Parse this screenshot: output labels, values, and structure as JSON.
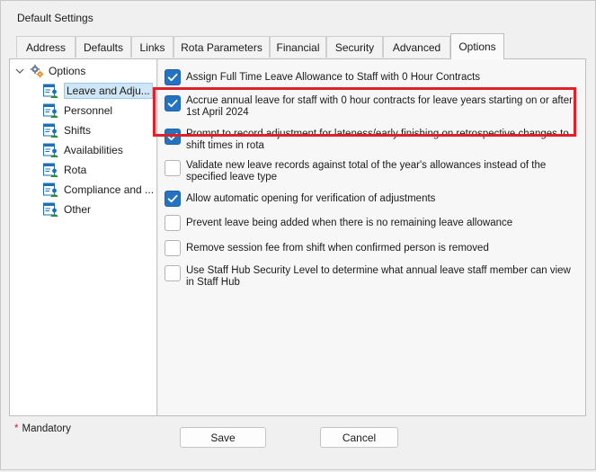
{
  "window": {
    "title": "Default Settings"
  },
  "tabs": [
    {
      "label": "Address"
    },
    {
      "label": "Defaults"
    },
    {
      "label": "Links"
    },
    {
      "label": "Rota Parameters"
    },
    {
      "label": "Financial"
    },
    {
      "label": "Security"
    },
    {
      "label": "Advanced"
    },
    {
      "label": "Options",
      "active": true
    }
  ],
  "tree": {
    "root": {
      "label": "Options",
      "icon": "gears-icon",
      "expanded": true
    },
    "items": [
      {
        "label": "Leave and Adju...",
        "icon": "person-document-icon",
        "selected": true
      },
      {
        "label": "Personnel",
        "icon": "person-document-icon"
      },
      {
        "label": "Shifts",
        "icon": "person-document-icon"
      },
      {
        "label": "Availabilities",
        "icon": "person-document-icon"
      },
      {
        "label": "Rota",
        "icon": "person-document-icon"
      },
      {
        "label": "Compliance and ...",
        "icon": "person-document-icon"
      },
      {
        "label": "Other",
        "icon": "person-document-icon"
      }
    ]
  },
  "options": [
    {
      "label": "Assign Full Time Leave Allowance to Staff with 0 Hour Contracts",
      "checked": true
    },
    {
      "label": "Accrue annual leave for staff with 0 hour contracts for leave years starting on or after 1st April 2024",
      "checked": true,
      "highlighted": true
    },
    {
      "label": "Prompt to record adjustment for lateness/early finishing on retrospective changes to shift times in rota",
      "checked": true
    },
    {
      "label": "Validate new leave records against total of the year's allowances instead of the specified leave type",
      "checked": false
    },
    {
      "label": "Allow automatic opening for verification of adjustments",
      "checked": true
    },
    {
      "label": "Prevent leave being added when there is no remaining leave allowance",
      "checked": false
    },
    {
      "label": "Remove session fee from shift when confirmed person is removed",
      "checked": false
    },
    {
      "label": "Use Staff Hub Security Level to determine what annual leave staff member can view in Staff Hub",
      "checked": false
    }
  ],
  "footer": {
    "mandatory_star": "*",
    "mandatory_label": "Mandatory",
    "save_label": "Save",
    "cancel_label": "Cancel"
  },
  "colors": {
    "checkbox_checked": "#2473c2",
    "highlight_border": "#e0202a",
    "selection": "#cfe6f7"
  }
}
